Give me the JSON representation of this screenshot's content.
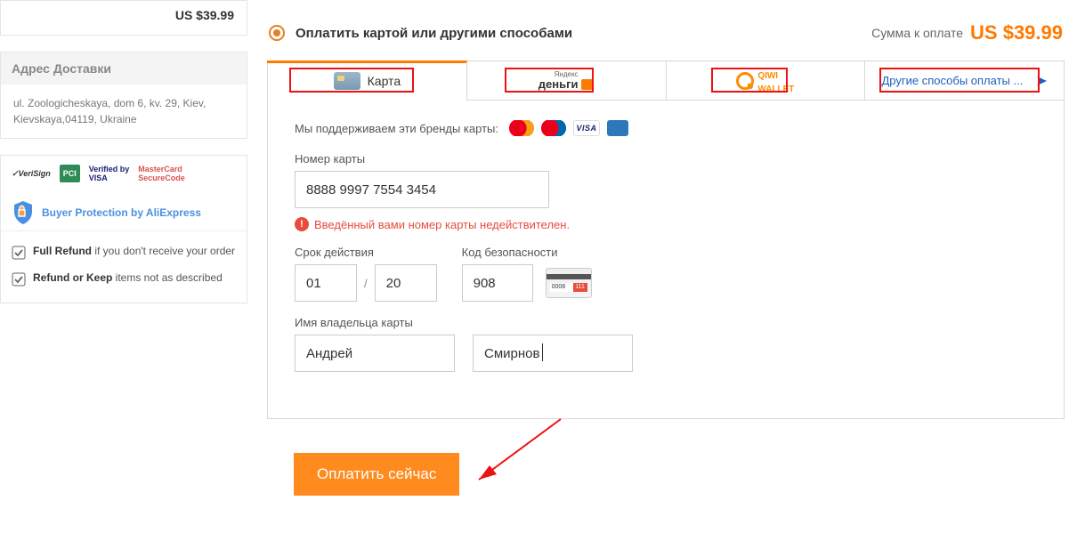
{
  "sidebar": {
    "price_top": "US $39.99",
    "shipping_header": "Адрес Доставки",
    "shipping_address": "ul. Zoologicheskaya, dom 6, kv. 29, Kiev, Kievskaya,04119, Ukraine",
    "protection_label": "Buyer Protection by AliExpress",
    "refund_full_bold": "Full Refund",
    "refund_full_rest": " if you don't receive your order",
    "refund_keep_bold": "Refund or Keep",
    "refund_keep_rest": " items not as described",
    "trust_logos": [
      "VeriSign",
      "PCI",
      "Verified by VISA",
      "MasterCard SecureCode"
    ]
  },
  "payment": {
    "method_title": "Оплатить картой или другими способами",
    "amount_label": "Сумма к оплате",
    "amount_value": "US $39.99",
    "tabs": {
      "card": "Карта",
      "yandex_small": "Яндекс",
      "yandex_big": "деньги",
      "qiwi_line1": "QIWI",
      "qiwi_line2": "WALLET",
      "other": "Другие способы оплаты ..."
    },
    "support_text": "Мы поддерживаем эти бренды карты:",
    "card_brands": [
      "mastercard",
      "maestro",
      "visa",
      "amex"
    ],
    "labels": {
      "card_number": "Номер карты",
      "expiry": "Срок действия",
      "cvv": "Код безопасности",
      "cardholder": "Имя владельца карты"
    },
    "values": {
      "card_number": "8888 9997 7554 3454",
      "exp_month": "01",
      "exp_year": "20",
      "cvv": "908",
      "first_name": "Андрей",
      "last_name": "Смирнов"
    },
    "cvv_hint": {
      "sign": "0008",
      "code": "111"
    },
    "error_text": "Введённый вами номер карты недействителен.",
    "pay_button": "Оплатить сейчас"
  }
}
